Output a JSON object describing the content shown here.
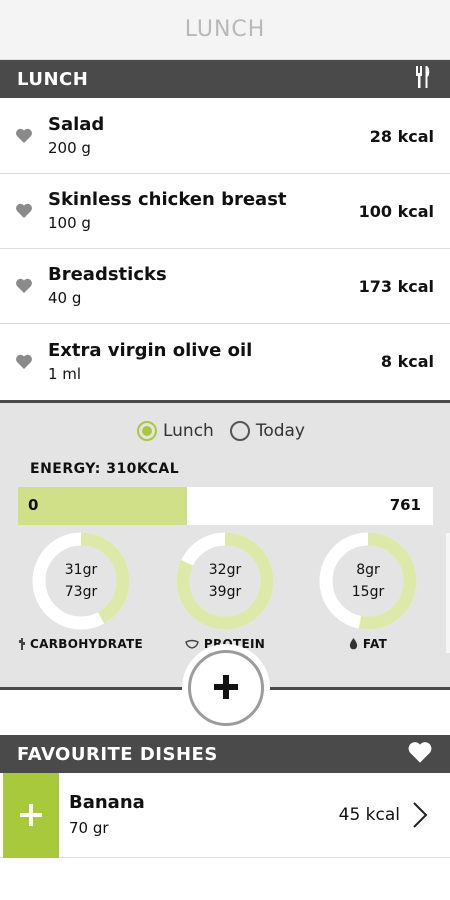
{
  "header": {
    "title": "LUNCH"
  },
  "meal_section": {
    "title": "LUNCH",
    "icon": "cutlery-icon"
  },
  "foods": [
    {
      "name": "Salad",
      "qty": "200 g",
      "kcal": "28 kcal"
    },
    {
      "name": "Skinless chicken breast",
      "qty": "100 g",
      "kcal": "100 kcal"
    },
    {
      "name": "Breadsticks",
      "qty": "40 g",
      "kcal": "173 kcal"
    },
    {
      "name": "Extra virgin olive oil",
      "qty": "1 ml",
      "kcal": "8 kcal"
    }
  ],
  "summary": {
    "toggle": {
      "options": [
        "Lunch",
        "Today"
      ],
      "selected": "Lunch"
    },
    "energy_label": "ENERGY: 310KCAL",
    "energy_bar": {
      "min": "0",
      "max": "761",
      "fill_fraction": 0.407
    },
    "macros": [
      {
        "label": "CARBOHYDRATE",
        "current": "31gr",
        "target": "73gr",
        "progress": 0.42,
        "icon": "wheat-icon"
      },
      {
        "label": "PROTEIN",
        "current": "32gr",
        "target": "39gr",
        "progress": 0.82,
        "icon": "steak-icon"
      },
      {
        "label": "FAT",
        "current": "8gr",
        "target": "15gr",
        "progress": 0.53,
        "icon": "drop-icon"
      }
    ]
  },
  "add_button": {
    "icon": "plus-icon"
  },
  "favourites": {
    "title": "FAVOURITE DISHES",
    "icon": "heart-icon",
    "items": [
      {
        "name": "Banana",
        "qty": "70 gr",
        "kcal": "45 kcal"
      }
    ]
  },
  "colors": {
    "accent": "#a8c93c",
    "accent_light": "#cfe088",
    "bar": "#4a4a4a",
    "panel": "#e4e4e4"
  }
}
